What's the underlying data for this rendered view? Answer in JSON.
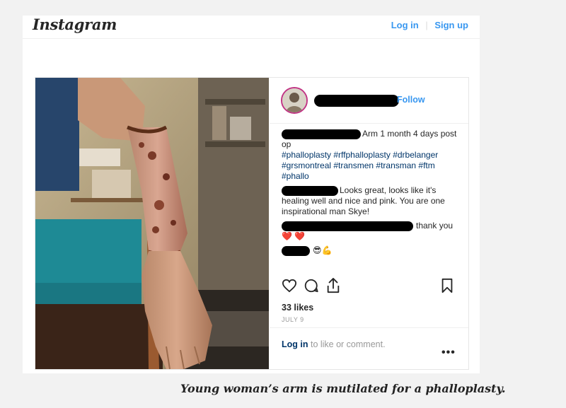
{
  "header": {
    "logo_text": "Instagram",
    "login_label": "Log in",
    "separator": "|",
    "signup_label": "Sign up"
  },
  "post": {
    "follow_label": "Follow",
    "comments": [
      {
        "text": "Arm 1 month 4 days post op"
      },
      {
        "hashtags": "#phalloplasty #rffphalloplasty #drbelanger #grsmontreal #transmen #transman #ftm #phallo"
      },
      {
        "text": "Looks great, looks like it's healing well and nice and pink. You are one inspirational man Skye!"
      },
      {
        "text": "thank you",
        "emoji": "❤️ ❤️"
      },
      {
        "emoji": "😎💪"
      }
    ],
    "likes": "33 likes",
    "date": "JULY 9",
    "login_prompt_link": "Log in",
    "login_prompt_rest": " to like or comment.",
    "more_label": "•••"
  },
  "caption": "Young woman’s arm is mutilated for a phalloplasty.",
  "colors": {
    "link_blue": "#3897f0",
    "hashtag_navy": "#003569",
    "heart_red": "#ed4956"
  },
  "icons": [
    "heart-icon",
    "comment-icon",
    "share-icon",
    "bookmark-icon",
    "avatar"
  ]
}
